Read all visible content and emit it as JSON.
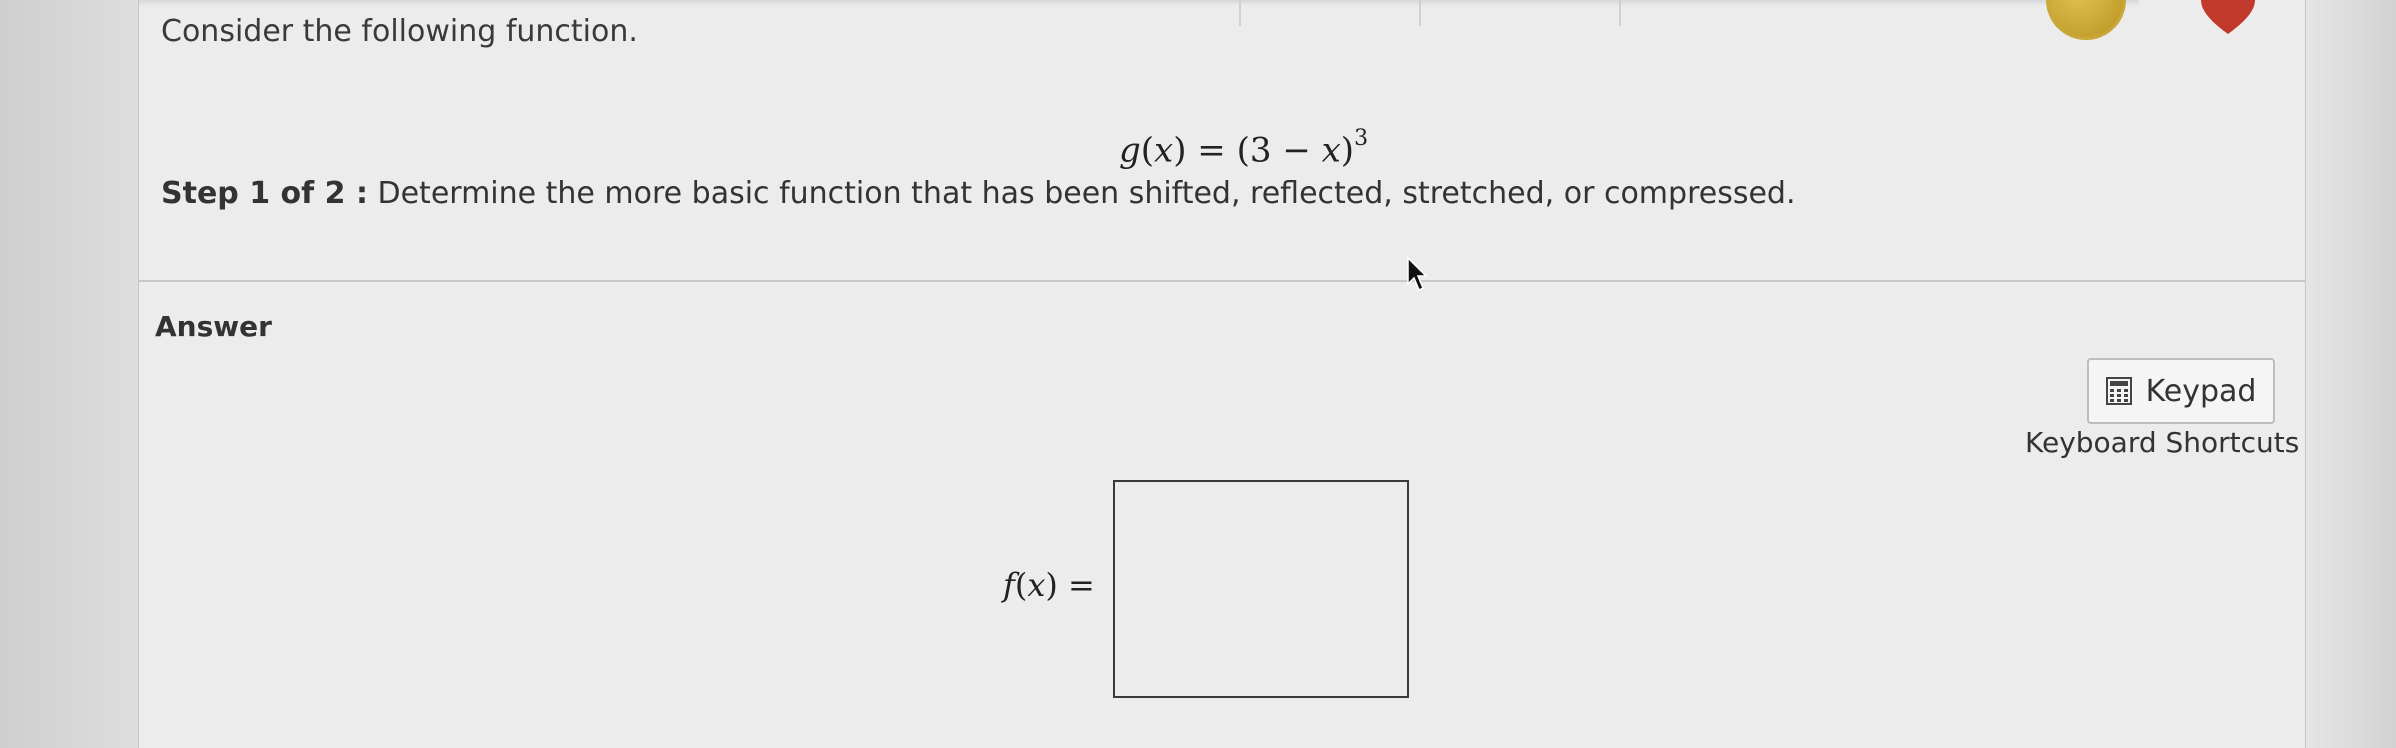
{
  "question": {
    "prompt": "Consider the following function.",
    "equation": {
      "fname": "g",
      "var": "x",
      "eq": "=",
      "base_open": "(3 − ",
      "base_close": ")",
      "exponent": "3"
    },
    "step": {
      "label": "Step 1 of 2 :",
      "text": "Determine the more basic function that has been shifted, reflected, stretched, or compressed."
    }
  },
  "answer": {
    "label": "Answer",
    "keypad_label": "Keypad",
    "shortcuts_label": "Keyboard Shortcuts",
    "fx": {
      "fname": "f",
      "var": "x",
      "eq": "="
    },
    "input_value": ""
  },
  "colors": {
    "badge_gold": "#c9a83a",
    "heart_red": "#c0392b"
  },
  "icons": {
    "keypad": "calculator-icon",
    "cursor": "mouse-pointer-icon"
  }
}
